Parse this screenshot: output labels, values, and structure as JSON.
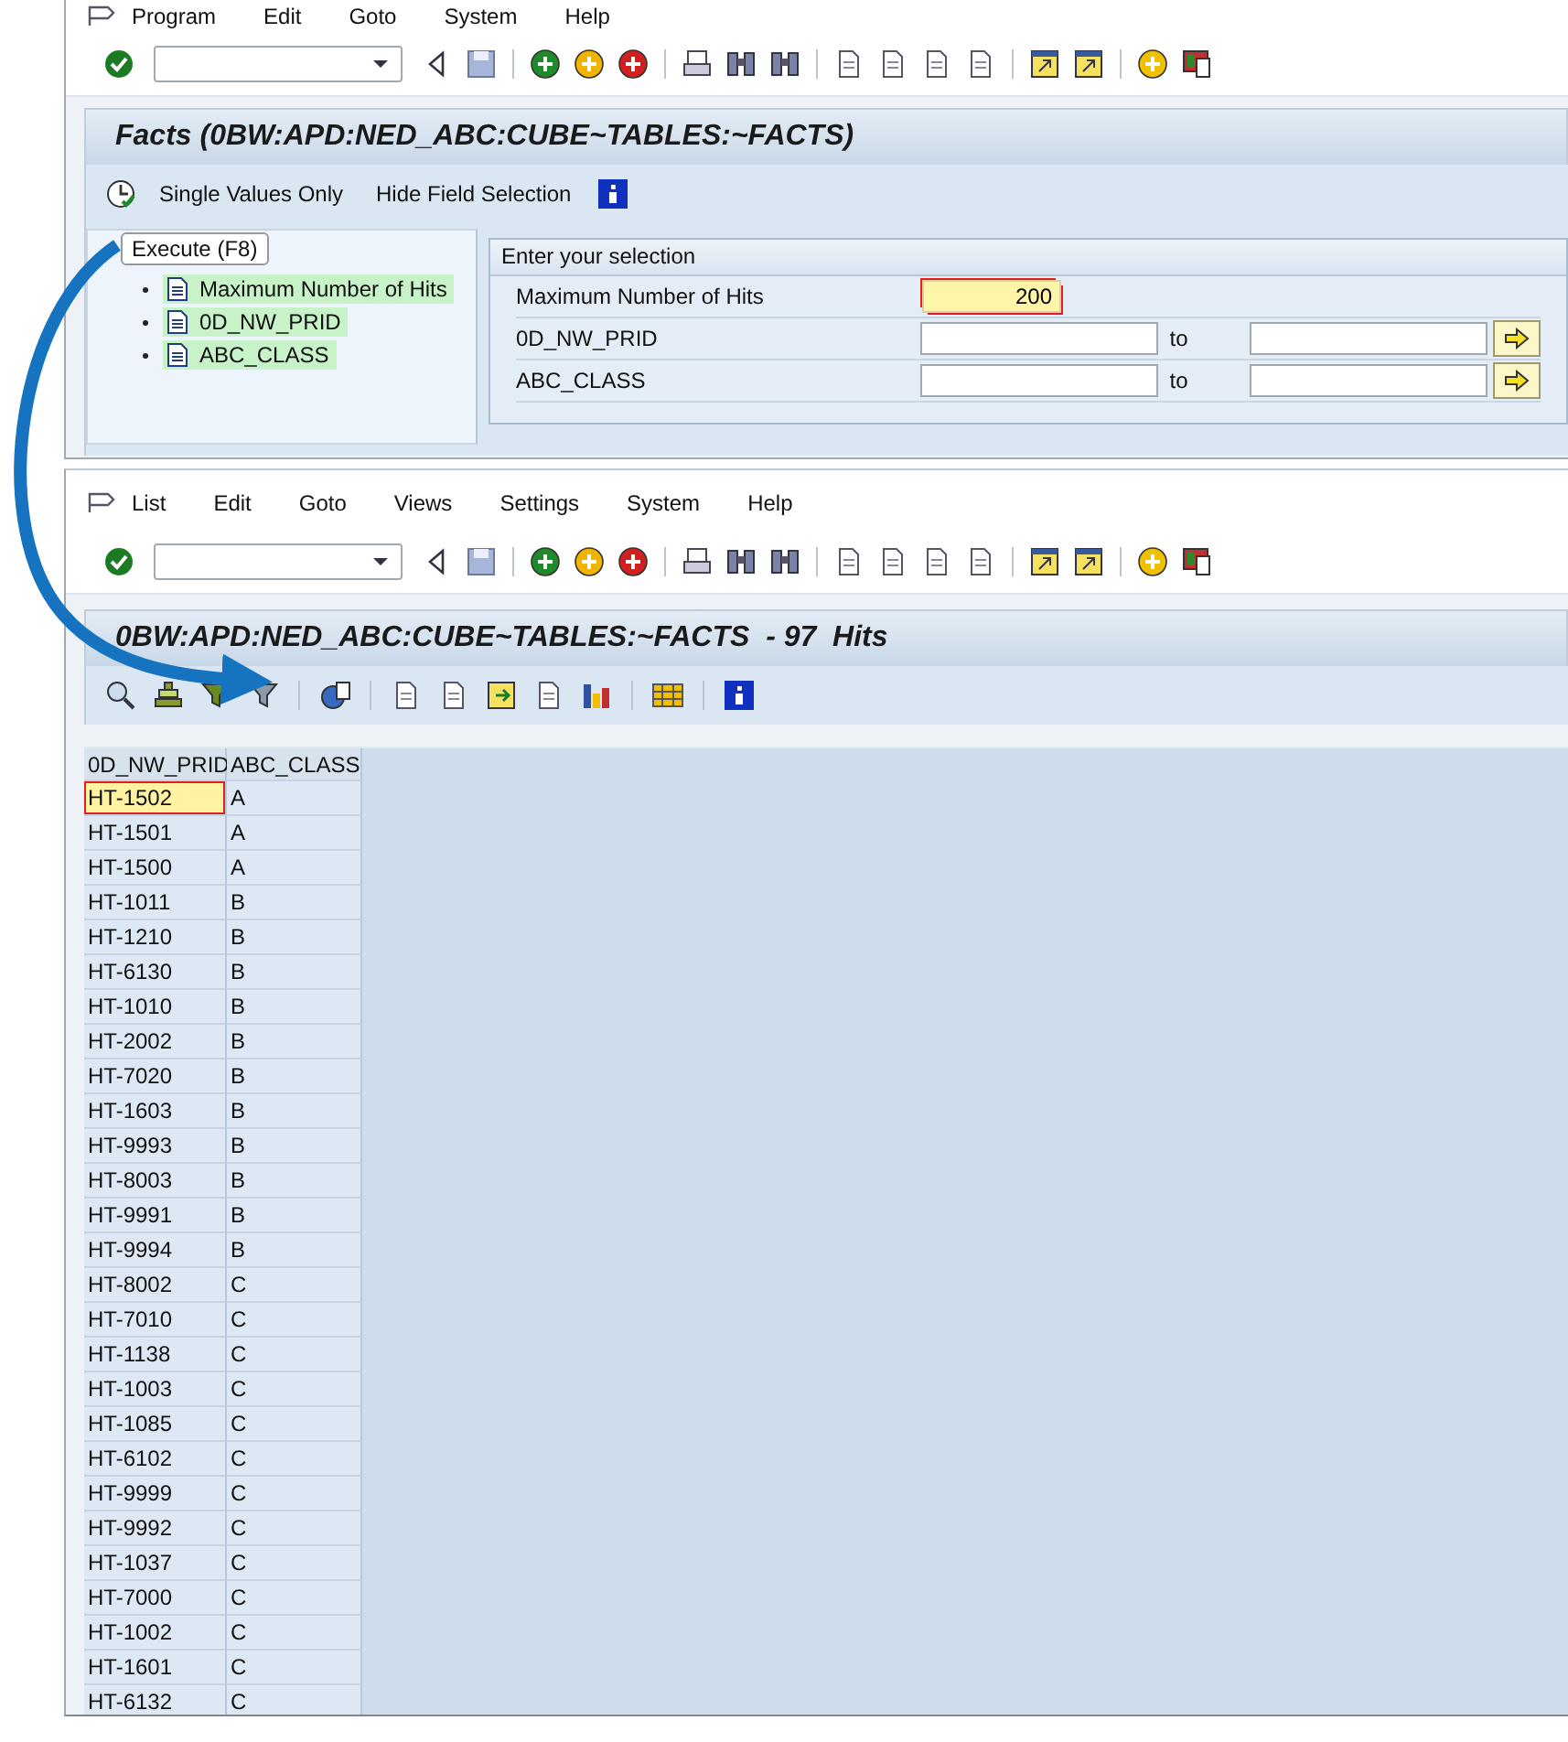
{
  "selection_screen": {
    "menu": [
      "Program",
      "Edit",
      "Goto",
      "System",
      "Help"
    ],
    "title": "Facts (0BW:APD:NED_ABC:CUBE~TABLES:~FACTS)",
    "app_toolbar": [
      "Single Values Only",
      "Hide Field Selection"
    ],
    "tree": {
      "root": "Execute   (F8)",
      "items": [
        {
          "label": "Maximum Number of Hits",
          "highlighted": true
        },
        {
          "label": "0D_NW_PRID",
          "highlighted": true
        },
        {
          "label": "ABC_CLASS",
          "highlighted": true
        }
      ]
    },
    "group": {
      "title": "Enter your selection",
      "fields": [
        {
          "kind": "single",
          "label": "Maximum Number of Hits",
          "value": "200",
          "required": true
        },
        {
          "kind": "range",
          "label": "0D_NW_PRID",
          "to_label": "to",
          "required": false
        },
        {
          "kind": "range",
          "label": "ABC_CLASS",
          "to_label": "to",
          "required": false
        }
      ]
    }
  },
  "result_list": {
    "menu": [
      "List",
      "Edit",
      "Goto",
      "Views",
      "Settings",
      "System",
      "Help"
    ],
    "title": "0BW:APD:NED_ABC:CUBE~TABLES:~FACTS  - 97  Hits",
    "table": {
      "columns": [
        "0D_NW_PRID",
        "ABC_CLASS"
      ],
      "rows": [
        {
          "cells": [
            "HT-1502",
            "A"
          ],
          "selected": true
        },
        {
          "cells": [
            "HT-1501",
            "A"
          ],
          "selected": false
        },
        {
          "cells": [
            "HT-1500",
            "A"
          ],
          "selected": false
        },
        {
          "cells": [
            "HT-1011",
            "B"
          ],
          "selected": false
        },
        {
          "cells": [
            "HT-1210",
            "B"
          ],
          "selected": false
        },
        {
          "cells": [
            "HT-6130",
            "B"
          ],
          "selected": false
        },
        {
          "cells": [
            "HT-1010",
            "B"
          ],
          "selected": false
        },
        {
          "cells": [
            "HT-2002",
            "B"
          ],
          "selected": false
        },
        {
          "cells": [
            "HT-7020",
            "B"
          ],
          "selected": false
        },
        {
          "cells": [
            "HT-1603",
            "B"
          ],
          "selected": false
        },
        {
          "cells": [
            "HT-9993",
            "B"
          ],
          "selected": false
        },
        {
          "cells": [
            "HT-8003",
            "B"
          ],
          "selected": false
        },
        {
          "cells": [
            "HT-9991",
            "B"
          ],
          "selected": false
        },
        {
          "cells": [
            "HT-9994",
            "B"
          ],
          "selected": false
        },
        {
          "cells": [
            "HT-8002",
            "C"
          ],
          "selected": false
        },
        {
          "cells": [
            "HT-7010",
            "C"
          ],
          "selected": false
        },
        {
          "cells": [
            "HT-1138",
            "C"
          ],
          "selected": false
        },
        {
          "cells": [
            "HT-1003",
            "C"
          ],
          "selected": false
        },
        {
          "cells": [
            "HT-1085",
            "C"
          ],
          "selected": false
        },
        {
          "cells": [
            "HT-6102",
            "C"
          ],
          "selected": false
        },
        {
          "cells": [
            "HT-9999",
            "C"
          ],
          "selected": false
        },
        {
          "cells": [
            "HT-9992",
            "C"
          ],
          "selected": false
        },
        {
          "cells": [
            "HT-1037",
            "C"
          ],
          "selected": false
        },
        {
          "cells": [
            "HT-7000",
            "C"
          ],
          "selected": false
        },
        {
          "cells": [
            "HT-1002",
            "C"
          ],
          "selected": false
        },
        {
          "cells": [
            "HT-1601",
            "C"
          ],
          "selected": false
        },
        {
          "cells": [
            "HT-6132",
            "C"
          ],
          "selected": false
        }
      ]
    }
  }
}
